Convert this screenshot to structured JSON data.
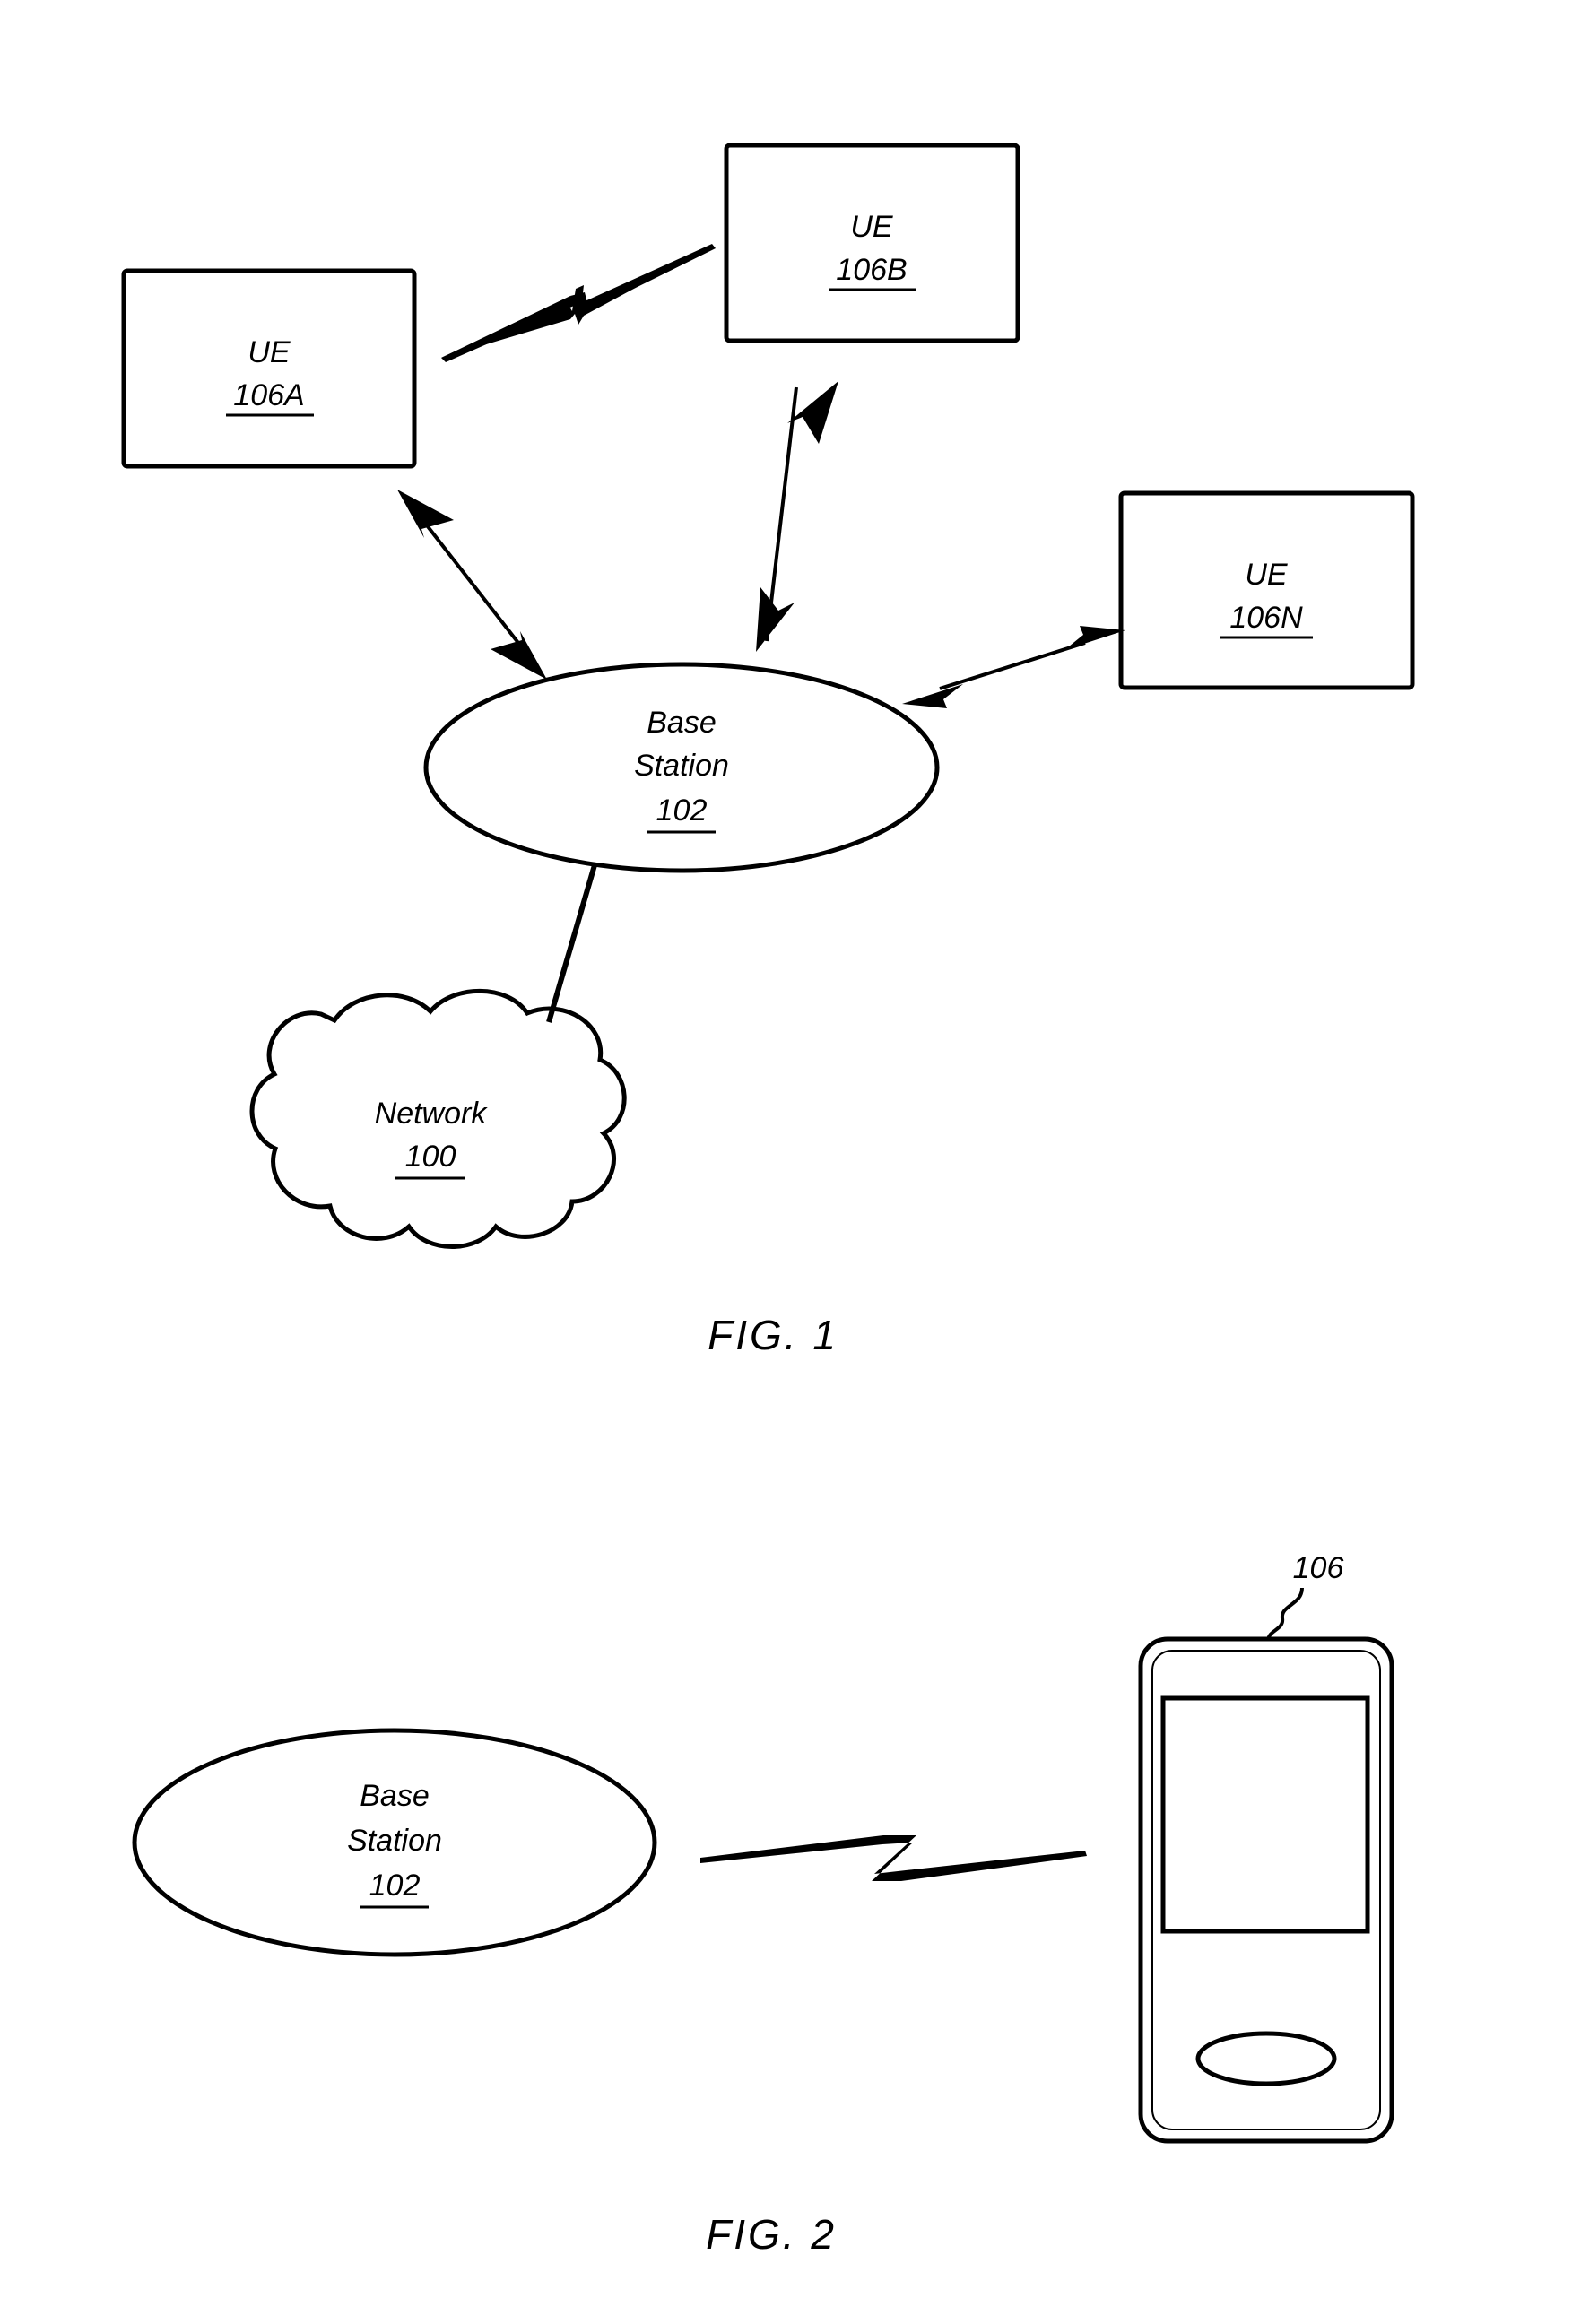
{
  "document": {
    "type": "patent-figure-sheet",
    "background_color": "#ffffff",
    "line_color": "#000000"
  },
  "figures": [
    {
      "id": "fig1",
      "caption": "FIG. 1",
      "nodes": [
        {
          "key": "ue_106a",
          "shape": "rectangle",
          "label_line1": "UE",
          "label_line2": "106A",
          "underlined_ref": "106A"
        },
        {
          "key": "ue_106b",
          "shape": "rectangle",
          "label_line1": "UE",
          "label_line2": "106B",
          "underlined_ref": "106B"
        },
        {
          "key": "ue_106n",
          "shape": "rectangle",
          "label_line1": "UE",
          "label_line2": "106N",
          "underlined_ref": "106N"
        },
        {
          "key": "base_station_102",
          "shape": "ellipse",
          "label_line1": "Base",
          "label_line2": "Station",
          "label_line3": "102",
          "underlined_ref": "102"
        },
        {
          "key": "network_100",
          "shape": "cloud",
          "label_line1": "Network",
          "label_line2": "100",
          "underlined_ref": "100"
        }
      ],
      "connectors": [
        {
          "key": "ue106a-ue106b",
          "type": "lightning-bolt",
          "from": "ue_106a",
          "to": "ue_106b"
        },
        {
          "key": "ue106a-base",
          "type": "double-arrow",
          "from": "ue_106a",
          "to": "base_station_102"
        },
        {
          "key": "ue106b-base",
          "type": "double-arrow",
          "from": "ue_106b",
          "to": "base_station_102"
        },
        {
          "key": "ue106n-base",
          "type": "double-arrow",
          "from": "ue_106n",
          "to": "base_station_102"
        },
        {
          "key": "base-network",
          "type": "plain-line",
          "from": "base_station_102",
          "to": "network_100"
        }
      ]
    },
    {
      "id": "fig2",
      "caption": "FIG. 2",
      "nodes": [
        {
          "key": "base_station_102_fig2",
          "shape": "ellipse",
          "label_line1": "Base",
          "label_line2": "Station",
          "label_line3": "102",
          "underlined_ref": "102"
        },
        {
          "key": "ue_device_106",
          "shape": "mobile-device",
          "ref_label": "106",
          "parts": [
            "device-body",
            "device-bezel",
            "device-screen",
            "device-home-button"
          ]
        }
      ],
      "connectors": [
        {
          "key": "base-device",
          "type": "lightning-bolt",
          "from": "base_station_102_fig2",
          "to": "ue_device_106"
        }
      ]
    }
  ]
}
